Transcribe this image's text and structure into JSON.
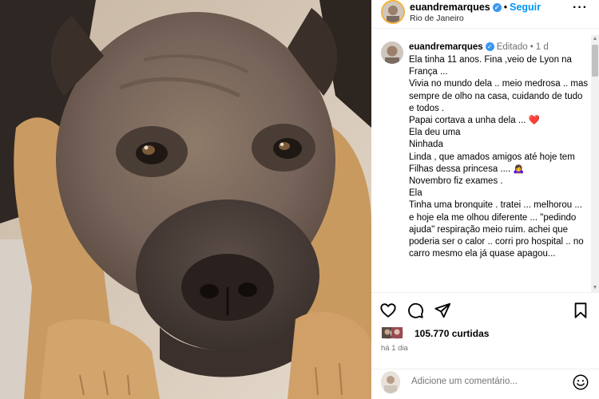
{
  "post": {
    "username": "euandremarques",
    "location": "Rio de Janeiro",
    "follow_label": "Seguir",
    "dot": "•",
    "more_label": "···"
  },
  "caption": {
    "username": "euandremarques",
    "edited_label": "Editado",
    "age": "1 d",
    "lines": [
      "Ela tinha 11 anos. Fina ,veio de Lyon na França ...",
      "Vivia no mundo dela .. meio medrosa .. mas sempre de olho na casa, cuidando de tudo e todos .",
      "Papai cortava a unha dela ... ❤️",
      "Ela deu uma",
      "Ninhada",
      "Linda , que amados amigos até hoje tem",
      "Filhas dessa princesa .... 🙇‍♀️",
      "Novembro fiz exames .",
      "Ela",
      "Tinha uma bronquite . tratei ... melhorou ... e hoje ela me olhou diferente ... \"pedindo ajuda\" respiração meio ruim. achei que poderia ser o calor .. corri pro hospital .. no carro mesmo ela já quase apagou..."
    ]
  },
  "engagement": {
    "likes_count": "105.770",
    "likes_word": "curtidas",
    "time_ago": "há 1 dia"
  },
  "comment_box": {
    "placeholder": "Adicione um comentário..."
  },
  "icons": {
    "like": "heart-icon",
    "comment": "comment-icon",
    "share": "send-icon",
    "save": "bookmark-icon",
    "emoji": "emoji-icon",
    "more": "more-options-icon",
    "verified": "verified-badge-icon"
  },
  "colors": {
    "link": "#0095f6",
    "verified": "#3897f0",
    "muted": "#737373",
    "heart": "#e0245e"
  }
}
